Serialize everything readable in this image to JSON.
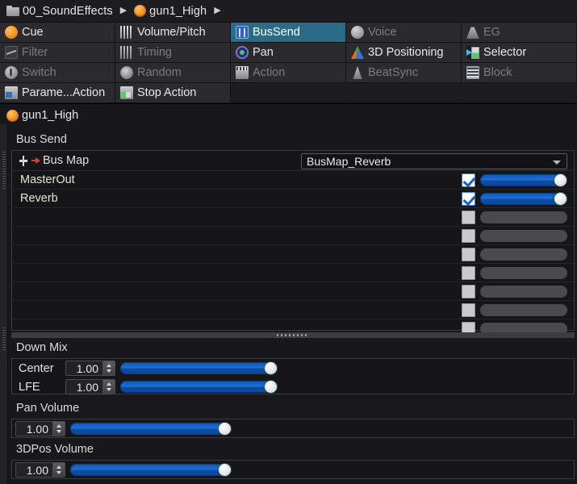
{
  "breadcrumb": {
    "items": [
      {
        "label": "00_SoundEffects",
        "icon": "folder-icon"
      },
      {
        "label": "gun1_High",
        "icon": "sound-object-icon"
      }
    ],
    "separator": "▶"
  },
  "tabs": {
    "rows": [
      [
        {
          "label": "Cue",
          "icon": "cue-icon",
          "state": "normal",
          "col": 0
        },
        {
          "label": "Volume/Pitch",
          "icon": "volume-pitch-icon",
          "state": "normal",
          "col": 1
        },
        {
          "label": "BusSend",
          "icon": "bus-send-icon",
          "state": "selected",
          "col": 2
        },
        {
          "label": "Voice",
          "icon": "voice-icon",
          "state": "disabled",
          "col": 3
        },
        {
          "label": "EG",
          "icon": "eg-icon",
          "state": "disabled",
          "col": 4
        }
      ],
      [
        {
          "label": "Filter",
          "icon": "filter-icon",
          "state": "disabled",
          "col": 0
        },
        {
          "label": "Timing",
          "icon": "timing-icon",
          "state": "disabled",
          "col": 1
        },
        {
          "label": "Pan",
          "icon": "pan-icon",
          "state": "normal",
          "col": 2
        },
        {
          "label": "3D Positioning",
          "icon": "3d-positioning-icon",
          "state": "normal",
          "col": 3
        },
        {
          "label": "Selector",
          "icon": "selector-icon",
          "state": "normal",
          "col": 4
        }
      ],
      [
        {
          "label": "Switch",
          "icon": "switch-icon",
          "state": "disabled",
          "col": 0
        },
        {
          "label": "Random",
          "icon": "random-icon",
          "state": "disabled",
          "col": 1
        },
        {
          "label": "Action",
          "icon": "action-icon",
          "state": "disabled",
          "col": 2
        },
        {
          "label": "BeatSync",
          "icon": "beatsync-icon",
          "state": "disabled",
          "col": 3
        },
        {
          "label": "Block",
          "icon": "block-icon",
          "state": "disabled",
          "col": 4
        }
      ],
      [
        {
          "label": "Parame...Action",
          "icon": "parameter-action-icon",
          "state": "normal",
          "col": 0
        },
        {
          "label": "Stop Action",
          "icon": "stop-action-icon",
          "state": "normal",
          "col": 1
        },
        {
          "label": "",
          "icon": "",
          "state": "empty",
          "col": 2
        },
        {
          "label": "",
          "icon": "",
          "state": "empty",
          "col": 3
        },
        {
          "label": "",
          "icon": "",
          "state": "empty",
          "col": 4
        }
      ]
    ]
  },
  "object_header": {
    "name": "gun1_High",
    "icon": "sound-object-icon"
  },
  "bus_send": {
    "title": "Bus Send",
    "bus_map": {
      "label": "Bus Map",
      "icon": "bus-map-route-icon",
      "value": "BusMap_Reverb"
    },
    "rows": [
      {
        "name": "MasterOut",
        "enabled": true,
        "level": 1.0
      },
      {
        "name": "Reverb",
        "enabled": true,
        "level": 1.0
      },
      {
        "name": "",
        "enabled": false,
        "level": 0.0
      },
      {
        "name": "",
        "enabled": false,
        "level": 0.0
      },
      {
        "name": "",
        "enabled": false,
        "level": 0.0
      },
      {
        "name": "",
        "enabled": false,
        "level": 0.0
      },
      {
        "name": "",
        "enabled": false,
        "level": 0.0
      },
      {
        "name": "",
        "enabled": false,
        "level": 0.0
      },
      {
        "name": "",
        "enabled": false,
        "level": 0.0
      }
    ]
  },
  "down_mix": {
    "title": "Down Mix",
    "controls": [
      {
        "label": "Center",
        "value": "1.00",
        "slider": 1.0
      },
      {
        "label": "LFE",
        "value": "1.00",
        "slider": 1.0
      }
    ]
  },
  "pan_volume": {
    "title": "Pan Volume",
    "value": "1.00",
    "slider": 1.0
  },
  "pos3d_volume": {
    "title": "3DPos Volume",
    "value": "1.00",
    "slider": 1.0
  },
  "colors": {
    "background": "#18181a",
    "tab_normal": "#2b2b2e",
    "tab_selected": "#2b6b86",
    "accent_orange": "#f79a2a",
    "slider_blue": "#1f6fd4",
    "text": "#e8e8e8",
    "text_disabled": "#7c7c80"
  }
}
